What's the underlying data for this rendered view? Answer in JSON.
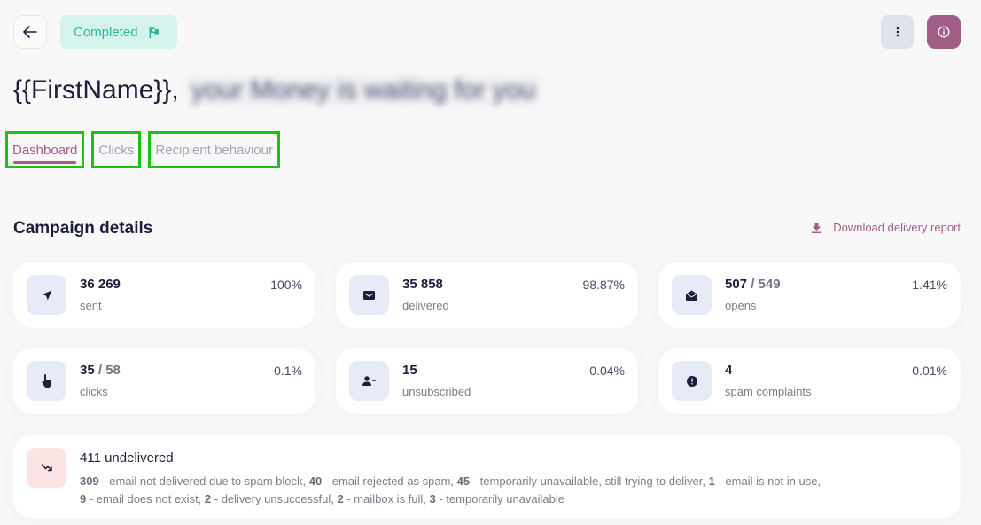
{
  "header": {
    "back_icon": "arrow-left-icon",
    "status": {
      "label": "Completed",
      "icon": "flag-icon",
      "color": "#2cb8a0",
      "background": "#d3f3ec"
    },
    "more_icon": "more-vertical-icon",
    "info_icon": "info-icon",
    "accent_color": "#a05d85"
  },
  "title": {
    "visible": "{{FirstName}},",
    "blurred": "your Money is waiting for you"
  },
  "tabs": [
    {
      "label": "Dashboard",
      "active": true
    },
    {
      "label": "Clicks",
      "active": false
    },
    {
      "label": "Recipient behaviour",
      "active": false
    }
  ],
  "section": {
    "title": "Campaign details",
    "download_label": "Download delivery report",
    "download_icon": "download-icon"
  },
  "stats": [
    {
      "icon": "send-icon",
      "value": "36 269",
      "total": "",
      "label": "sent",
      "percent": "100%"
    },
    {
      "icon": "envelope-icon",
      "value": "35 858",
      "total": "",
      "label": "delivered",
      "percent": "98.87%"
    },
    {
      "icon": "envelope-open-icon",
      "value": "507",
      "total": "549",
      "label": "opens",
      "percent": "1.41%"
    },
    {
      "icon": "hand-pointer-icon",
      "value": "35",
      "total": "58",
      "label": "clicks",
      "percent": "0.1%"
    },
    {
      "icon": "user-minus-icon",
      "value": "15",
      "total": "",
      "label": "unsubscribed",
      "percent": "0.04%"
    },
    {
      "icon": "exclamation-circle-icon",
      "value": "4",
      "total": "",
      "label": "spam complaints",
      "percent": "0.01%"
    }
  ],
  "undelivered": {
    "icon": "trend-down-icon",
    "title": "411 undelivered",
    "reasons": [
      {
        "count": "309",
        "text": "email not delivered due to spam block"
      },
      {
        "count": "40",
        "text": "email rejected as spam"
      },
      {
        "count": "45",
        "text": "temporarily unavailable, still trying to deliver"
      },
      {
        "count": "1",
        "text": "email is not in use"
      },
      {
        "count": "9",
        "text": "email does not exist"
      },
      {
        "count": "2",
        "text": "delivery unsuccessful"
      },
      {
        "count": "2",
        "text": "mailbox is full"
      },
      {
        "count": "3",
        "text": "temporarily unavailable"
      }
    ]
  }
}
